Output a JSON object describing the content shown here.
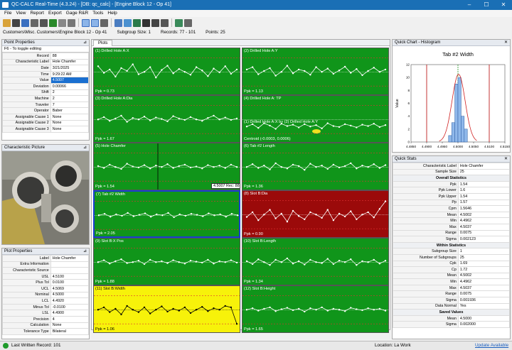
{
  "title_text": "QC-CALC Real-Time (4.3.24) - [DB: qc_calc] - [Engine Block 12 - Op 41]",
  "menu": [
    "File",
    "View",
    "Report",
    "Export",
    "Gage R&R",
    "Tools",
    "Help"
  ],
  "info": {
    "path": "Customers\\Misc. Customers\\Engine Block 12 - Op 41",
    "subgroup": "Subgroup Size: 1",
    "records": "Records: 77 - 101",
    "points": "Points: 25"
  },
  "point_properties": {
    "title": "Point Properties",
    "hint": "F6 - To toggle editing",
    "rows": [
      [
        "Record",
        "88"
      ],
      [
        "Characteristic Label",
        "Hole Chamfer"
      ],
      [
        "Date",
        "3/21/2025"
      ],
      [
        "Time",
        "9:29:22 AM"
      ],
      [
        "Value",
        "4.5007"
      ],
      [
        "Deviation",
        "0.00066"
      ],
      [
        "Shift",
        "2"
      ],
      [
        "Machine",
        "2"
      ],
      [
        "Traveler",
        "7"
      ],
      [
        "Operator",
        "Baber"
      ],
      [
        "Assignable Cause 1",
        "None"
      ],
      [
        "Assignable Cause 2",
        "None"
      ],
      [
        "Assignable Cause 3",
        "None"
      ]
    ]
  },
  "characteristic_picture": {
    "title": "Characteristic Picture"
  },
  "plot_properties": {
    "title": "Plot Properties",
    "rows": [
      [
        "Label",
        "Hole Chamfer"
      ],
      [
        "Extra Information",
        ""
      ],
      [
        "Characteristic Source",
        ""
      ],
      [
        "USL",
        "4.5100"
      ],
      [
        "Plus Tol",
        "0.0100"
      ],
      [
        "UCL",
        "4.5069"
      ],
      [
        "Nominal",
        "4.5000"
      ],
      [
        "LCL",
        "4.4920"
      ],
      [
        "Minus Tol",
        "-0.0100"
      ],
      [
        "LSL",
        "4.4900"
      ],
      [
        "Precision",
        "4"
      ],
      [
        "Calculation",
        "None"
      ],
      [
        "Tolerance Type",
        "Bilateral"
      ]
    ]
  },
  "plots": {
    "tab": "Plots",
    "tooltip": "4.5007 Rec: 88",
    "cells": [
      {
        "title": "(1) Drilled Hole A:X",
        "ppk": "Ppk = 0.73",
        "bg": "#10951a",
        "values": [
          0.62,
          0.48,
          0.55,
          0.4,
          0.58,
          0.52,
          0.66,
          0.45,
          0.5,
          0.6,
          0.38,
          0.54,
          0.63,
          0.47,
          0.56,
          0.5,
          0.44,
          0.6,
          0.53,
          0.41,
          0.57,
          0.49,
          0.62,
          0.46,
          0.55
        ]
      },
      {
        "title": "(2) Drilled Hole A:Y",
        "ppk": "Ppk = 1.13",
        "bg": "#10951a",
        "values": [
          0.55,
          0.6,
          0.45,
          0.52,
          0.58,
          0.42,
          0.5,
          0.63,
          0.47,
          0.55,
          0.52,
          0.44,
          0.6,
          0.5,
          0.57,
          0.46,
          0.53,
          0.61,
          0.48,
          0.56,
          0.43,
          0.52,
          0.59,
          0.5,
          0.55
        ]
      },
      {
        "title": "(3) Drilled Hole A:Dia",
        "ppk": "Ppk = 1.67",
        "bg": "#10951a",
        "values": [
          0.5,
          0.55,
          0.47,
          0.52,
          0.58,
          0.45,
          0.53,
          0.5,
          0.56,
          0.48,
          0.54,
          0.51,
          0.46,
          0.57,
          0.52,
          0.49,
          0.55,
          0.5,
          0.47,
          0.53,
          0.58,
          0.5,
          0.54,
          0.49,
          0.52
        ]
      },
      {
        "title": "(4) Drilled Hole A: TP",
        "sub": "(1) Drilled Hole A:X by (2) Drilled Hole A:Y",
        "ppk": "Centroid (-0.0003, 0.0006)",
        "bg": "#10951a",
        "values": [
          0.35,
          0.4,
          0.32,
          0.42,
          0.37,
          0.3,
          0.41,
          0.36,
          0.39,
          0.33,
          0.4,
          0.35,
          0.38,
          0.31,
          0.42,
          0.36,
          0.34,
          0.4,
          0.37,
          0.33,
          0.39,
          0.36,
          0.41,
          0.34,
          0.38
        ]
      },
      {
        "title": "(5) Hole Chamfer",
        "ppk": "Ppk = 1.54",
        "bg": "#10951a",
        "values": [
          0.52,
          0.48,
          0.55,
          0.5,
          0.46,
          0.57,
          0.51,
          0.49,
          0.54,
          0.47,
          0.53,
          0.5,
          0.56,
          0.48,
          0.52,
          0.55,
          0.49,
          0.51,
          0.47,
          0.54,
          0.5,
          0.53,
          0.48,
          0.55,
          0.5
        ]
      },
      {
        "title": "(6) Tab #2 Length",
        "ppk": "Ppk = 1.36",
        "bg": "#10951a",
        "values": [
          0.5,
          0.56,
          0.48,
          0.53,
          0.45,
          0.58,
          0.5,
          0.47,
          0.55,
          0.52,
          0.44,
          0.57,
          0.5,
          0.53,
          0.46,
          0.55,
          0.49,
          0.52,
          0.58,
          0.47,
          0.53,
          0.5,
          0.56,
          0.48,
          0.54
        ]
      },
      {
        "title": "(7) Tab #2 Width",
        "ppk": "Ppk = 2.05",
        "bg": "#10951a",
        "selected": true,
        "values": [
          0.5,
          0.53,
          0.47,
          0.52,
          0.49,
          0.55,
          0.48,
          0.51,
          0.54,
          0.47,
          0.52,
          0.5,
          0.55,
          0.46,
          0.52,
          0.49,
          0.53,
          0.51,
          0.48,
          0.54,
          0.5,
          0.52,
          0.47,
          0.53,
          0.5
        ]
      },
      {
        "title": "(8) Slot B:Dia",
        "ppk": "Ppk = 0.90",
        "bg": "#9b0a0a",
        "values": [
          0.45,
          0.55,
          0.38,
          0.5,
          0.6,
          0.42,
          0.52,
          0.35,
          0.58,
          0.47,
          0.4,
          0.55,
          0.5,
          0.43,
          0.6,
          0.38,
          0.52,
          0.46,
          0.57,
          0.4,
          0.5,
          0.55,
          0.44,
          0.62,
          0.78
        ]
      },
      {
        "title": "(9) Slot B:X Pos",
        "ppk": "Ppk = 1.88",
        "bg": "#10951a",
        "values": [
          0.5,
          0.54,
          0.47,
          0.52,
          0.56,
          0.48,
          0.5,
          0.53,
          0.46,
          0.55,
          0.5,
          0.52,
          0.48,
          0.54,
          0.5,
          0.47,
          0.53,
          0.51,
          0.49,
          0.55,
          0.47,
          0.52,
          0.5,
          0.54,
          0.49
        ]
      },
      {
        "title": "(10) Slot B:Length",
        "ppk": "Ppk = 1.34",
        "bg": "#10951a",
        "values": [
          0.52,
          0.46,
          0.56,
          0.5,
          0.44,
          0.55,
          0.5,
          0.58,
          0.47,
          0.52,
          0.45,
          0.55,
          0.5,
          0.48,
          0.57,
          0.46,
          0.53,
          0.5,
          0.56,
          0.44,
          0.52,
          0.5,
          0.55,
          0.47,
          0.53
        ]
      },
      {
        "title": "(11) Slot B:Width",
        "ppk": "Ppk = 1.06",
        "bg": "#f7f20a",
        "values": [
          0.5,
          0.55,
          0.45,
          0.52,
          0.4,
          0.58,
          0.5,
          0.45,
          0.55,
          0.42,
          0.5,
          0.57,
          0.46,
          0.52,
          0.48,
          0.55,
          0.43,
          0.5,
          0.56,
          0.47,
          0.53,
          0.5,
          0.58,
          0.55,
          0.2
        ]
      },
      {
        "title": "(12) Slot B:Height",
        "ppk": "Ppk = 1.65",
        "bg": "#10951a",
        "values": [
          0.5,
          0.53,
          0.48,
          0.52,
          0.55,
          0.47,
          0.51,
          0.54,
          0.49,
          0.52,
          0.46,
          0.53,
          0.5,
          0.55,
          0.48,
          0.52,
          0.5,
          0.47,
          0.54,
          0.51,
          0.49,
          0.53,
          0.5,
          0.52,
          0.48
        ]
      }
    ]
  },
  "quick_chart": {
    "title": "Quick Chart - Histogram"
  },
  "chart_data": {
    "type": "bar",
    "title": "Tab #2 Width",
    "ylabel": "Value",
    "xticks": [
      "4.4850",
      "4.4900",
      "4.4950",
      "4.5000",
      "4.5050",
      "4.5100",
      "4.5150"
    ],
    "yticks": [
      "0",
      "2",
      "4",
      "6",
      "8",
      "10",
      "12"
    ],
    "bins": [
      4.4975,
      4.4985,
      4.4995,
      4.5005,
      4.5015,
      4.5025
    ],
    "counts": [
      1,
      3,
      9,
      10,
      4,
      2
    ],
    "ylim": [
      0,
      12
    ]
  },
  "quick_stats": {
    "title": "Quick Stats",
    "rows": [
      {
        "k": "Characteristic Label",
        "v": "Hole Chamfer"
      },
      {
        "k": "Sample Size",
        "v": "25"
      },
      {
        "h": "Overall Statistics"
      },
      {
        "k": "Ppk",
        "v": "1.54"
      },
      {
        "k": "Ppk Lower",
        "v": "1.6"
      },
      {
        "k": "Ppk Upper",
        "v": "1.54"
      },
      {
        "k": "Pp",
        "v": "1.57"
      },
      {
        "k": "Cpm",
        "v": "1.5646"
      },
      {
        "k": "Mean",
        "v": "4.5002"
      },
      {
        "k": "Min",
        "v": "4.4962"
      },
      {
        "k": "Max",
        "v": "4.5037"
      },
      {
        "k": "Range",
        "v": "0.0075"
      },
      {
        "k": "Sigma",
        "v": "0.002123"
      },
      {
        "h": "Within Statistics"
      },
      {
        "k": "Subgroup Size",
        "v": "1"
      },
      {
        "k": "Number of Subgroups",
        "v": "25"
      },
      {
        "k": "Cpk",
        "v": "1.69"
      },
      {
        "k": "Cp",
        "v": "1.72"
      },
      {
        "k": "Mean",
        "v": "4.5002"
      },
      {
        "k": "Min",
        "v": "4.4962"
      },
      {
        "k": "Max",
        "v": "4.5037"
      },
      {
        "k": "Range",
        "v": "0.0075"
      },
      {
        "k": "Sigma",
        "v": "0.001936"
      },
      {
        "k": "Data Normal",
        "v": "Yes"
      },
      {
        "h": "Saved Values"
      },
      {
        "k": "Mean",
        "v": "4.5000"
      },
      {
        "k": "Sigma",
        "v": "0.002000"
      }
    ]
  },
  "status": {
    "left": "Last Written Record: 101",
    "location": "Location: La Work",
    "update": "Update Available"
  }
}
